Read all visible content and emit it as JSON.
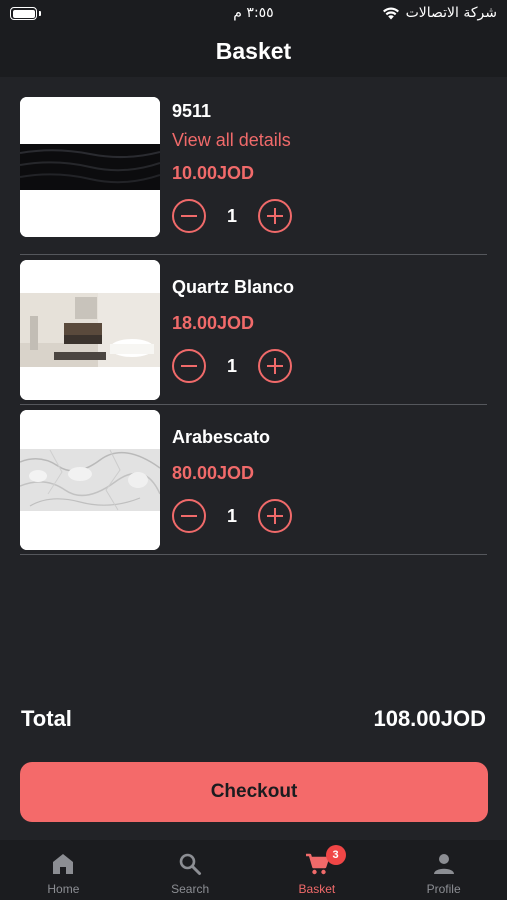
{
  "status_bar": {
    "time": "٣:٥٥ م",
    "carrier": "شركة الاتصالات"
  },
  "header": {
    "title": "Basket"
  },
  "items": [
    {
      "name": "9511",
      "details_link": "View all details",
      "price": "10.00JOD",
      "quantity": "1"
    },
    {
      "name": "Quartz Blanco",
      "price": "18.00JOD",
      "quantity": "1"
    },
    {
      "name": "Arabescato",
      "price": "80.00JOD",
      "quantity": "1"
    }
  ],
  "summary": {
    "total_label": "Total",
    "total_value": "108.00JOD"
  },
  "checkout_label": "Checkout",
  "tabbar": {
    "tabs": [
      {
        "label": "Home",
        "icon": "home-icon"
      },
      {
        "label": "Search",
        "icon": "search-icon"
      },
      {
        "label": "Basket",
        "icon": "cart-icon",
        "badge": "3",
        "active": true
      },
      {
        "label": "Profile",
        "icon": "person-icon"
      }
    ]
  },
  "colors": {
    "accent": "#f06a6a",
    "background": "#222327",
    "bar": "#1b1c1f",
    "badge": "#f04646"
  }
}
